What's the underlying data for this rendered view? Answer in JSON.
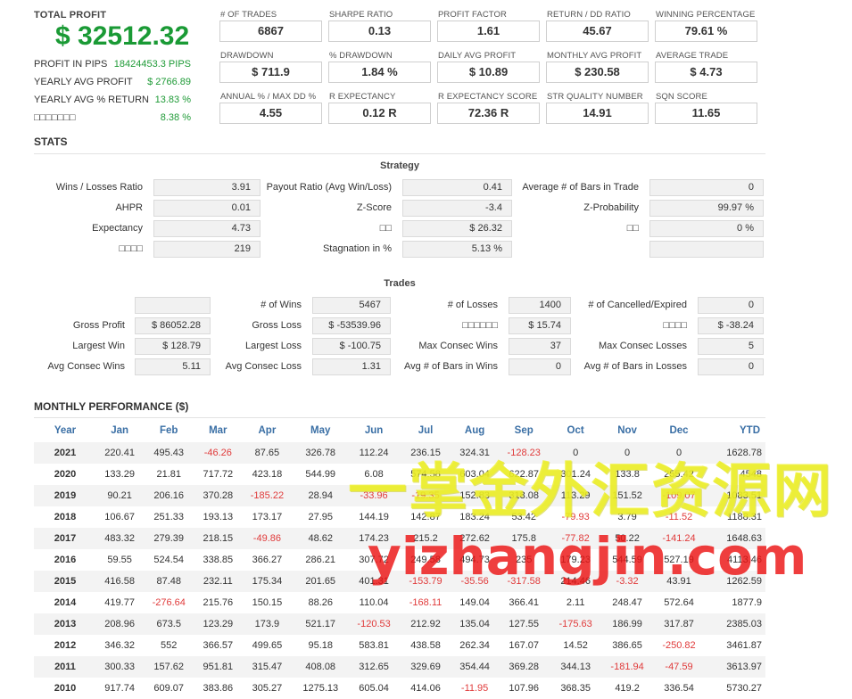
{
  "summary": {
    "total_profit_label": "TOTAL PROFIT",
    "total_profit_value": "$ 32512.32",
    "rows": [
      {
        "label": "PROFIT IN PIPS",
        "value": "18424453.3 PIPS"
      },
      {
        "label": "YEARLY AVG PROFIT",
        "value": "$ 2766.89"
      },
      {
        "label": "YEARLY AVG % RETURN",
        "value": "13.83 %"
      },
      {
        "label": "□□□□□□□",
        "value": "8.38 %"
      }
    ]
  },
  "stat_boxes": [
    {
      "label": "# OF TRADES",
      "value": "6867"
    },
    {
      "label": "SHARPE RATIO",
      "value": "0.13"
    },
    {
      "label": "PROFIT FACTOR",
      "value": "1.61"
    },
    {
      "label": "RETURN / DD RATIO",
      "value": "45.67"
    },
    {
      "label": "WINNING PERCENTAGE",
      "value": "79.61 %"
    },
    {
      "label": "DRAWDOWN",
      "value": "$ 711.9"
    },
    {
      "label": "% DRAWDOWN",
      "value": "1.84 %"
    },
    {
      "label": "DAILY AVG PROFIT",
      "value": "$ 10.89"
    },
    {
      "label": "MONTHLY AVG PROFIT",
      "value": "$ 230.58"
    },
    {
      "label": "AVERAGE TRADE",
      "value": "$ 4.73"
    },
    {
      "label": "ANNUAL % / MAX DD %",
      "value": "4.55"
    },
    {
      "label": "R EXPECTANCY",
      "value": "0.12 R"
    },
    {
      "label": "R EXPECTANCY SCORE",
      "value": "72.36 R"
    },
    {
      "label": "STR QUALITY NUMBER",
      "value": "14.91"
    },
    {
      "label": "SQN SCORE",
      "value": "11.65"
    }
  ],
  "stats_title": "STATS",
  "strategy": {
    "title": "Strategy",
    "rows": [
      [
        {
          "k": "Wins / Losses Ratio",
          "v": "3.91"
        },
        {
          "k": "Payout Ratio (Avg Win/Loss)",
          "v": "0.41"
        },
        {
          "k": "Average # of Bars in Trade",
          "v": "0"
        }
      ],
      [
        {
          "k": "AHPR",
          "v": "0.01"
        },
        {
          "k": "Z-Score",
          "v": "-3.4"
        },
        {
          "k": "Z-Probability",
          "v": "99.97 %"
        }
      ],
      [
        {
          "k": "Expectancy",
          "v": "4.73"
        },
        {
          "k": "□□",
          "v": "$ 26.32"
        },
        {
          "k": "□□",
          "v": "0 %"
        }
      ],
      [
        {
          "k": "□□□□",
          "v": "219"
        },
        {
          "k": "Stagnation in %",
          "v": "5.13 %"
        },
        {
          "k": "",
          "v": ""
        }
      ]
    ]
  },
  "trades": {
    "title": "Trades",
    "rows": [
      [
        {
          "k": "",
          "v": ""
        },
        {
          "k": "# of Wins",
          "v": "5467"
        },
        {
          "k": "# of Losses",
          "v": "1400"
        },
        {
          "k": "# of Cancelled/Expired",
          "v": "0"
        }
      ],
      [
        {
          "k": "Gross Profit",
          "v": "$ 86052.28"
        },
        {
          "k": "Gross Loss",
          "v": "$ -53539.96"
        },
        {
          "k": "□□□□□□",
          "v": "$ 15.74"
        },
        {
          "k": "□□□□",
          "v": "$ -38.24"
        }
      ],
      [
        {
          "k": "Largest Win",
          "v": "$ 128.79"
        },
        {
          "k": "Largest Loss",
          "v": "$ -100.75"
        },
        {
          "k": "Max Consec Wins",
          "v": "37"
        },
        {
          "k": "Max Consec Losses",
          "v": "5"
        }
      ],
      [
        {
          "k": "Avg Consec Wins",
          "v": "5.11"
        },
        {
          "k": "Avg Consec Loss",
          "v": "1.31"
        },
        {
          "k": "Avg # of Bars in Wins",
          "v": "0"
        },
        {
          "k": "Avg # of Bars in Losses",
          "v": "0"
        }
      ]
    ]
  },
  "monthly": {
    "title": "MONTHLY PERFORMANCE ($)",
    "headers": [
      "Year",
      "Jan",
      "Feb",
      "Mar",
      "Apr",
      "May",
      "Jun",
      "Jul",
      "Aug",
      "Sep",
      "Oct",
      "Nov",
      "Dec",
      "YTD"
    ],
    "rows": [
      [
        "2021",
        "220.41",
        "495.43",
        "-46.26",
        "87.65",
        "326.78",
        "112.24",
        "236.15",
        "324.31",
        "-128.23",
        "0",
        "0",
        "0",
        "1628.78"
      ],
      [
        "2020",
        "133.29",
        "21.81",
        "717.72",
        "423.18",
        "544.99",
        "6.08",
        "574.58",
        "603.04",
        "622.87",
        "301.24",
        "133.8",
        "255.42",
        "4548"
      ],
      [
        "2019",
        "90.21",
        "206.16",
        "370.28",
        "-185.22",
        "28.94",
        "-33.96",
        "-19.35",
        "152.83",
        "318.08",
        "113.29",
        "151.52",
        "-109.07",
        "1083.51"
      ],
      [
        "2018",
        "106.67",
        "251.33",
        "193.13",
        "173.17",
        "27.95",
        "144.19",
        "142.87",
        "183.24",
        "53.42",
        "-79.93",
        "3.79",
        "-11.52",
        "1188.31"
      ],
      [
        "2017",
        "483.32",
        "279.39",
        "218.15",
        "-49.86",
        "48.62",
        "174.23",
        "215.2",
        "272.62",
        "175.8",
        "-77.82",
        "50.22",
        "-141.24",
        "1648.63"
      ],
      [
        "2016",
        "59.55",
        "524.54",
        "338.85",
        "366.27",
        "286.21",
        "307.72",
        "249.58",
        "494.73",
        "235",
        "179.23",
        "544.59",
        "527.19",
        "4113.46"
      ],
      [
        "2015",
        "416.58",
        "87.48",
        "232.11",
        "175.34",
        "201.65",
        "401.31",
        "-153.79",
        "-35.56",
        "-317.58",
        "214.46",
        "-3.32",
        "43.91",
        "1262.59"
      ],
      [
        "2014",
        "419.77",
        "-276.64",
        "215.76",
        "150.15",
        "88.26",
        "110.04",
        "-168.11",
        "149.04",
        "366.41",
        "2.11",
        "248.47",
        "572.64",
        "1877.9"
      ],
      [
        "2013",
        "208.96",
        "673.5",
        "123.29",
        "173.9",
        "521.17",
        "-120.53",
        "212.92",
        "135.04",
        "127.55",
        "-175.63",
        "186.99",
        "317.87",
        "2385.03"
      ],
      [
        "2012",
        "346.32",
        "552",
        "366.57",
        "499.65",
        "95.18",
        "583.81",
        "438.58",
        "262.34",
        "167.07",
        "14.52",
        "386.65",
        "-250.82",
        "3461.87"
      ],
      [
        "2011",
        "300.33",
        "157.62",
        "951.81",
        "315.47",
        "408.08",
        "312.65",
        "329.69",
        "354.44",
        "369.28",
        "344.13",
        "-181.94",
        "-47.59",
        "3613.97"
      ],
      [
        "2010",
        "917.74",
        "609.07",
        "383.86",
        "305.27",
        "1275.13",
        "605.04",
        "414.06",
        "-11.95",
        "107.96",
        "368.35",
        "419.2",
        "336.54",
        "5730.27"
      ]
    ]
  },
  "watermark": {
    "line1": "一掌金外汇资源网",
    "line2": "yizhangjin.com"
  },
  "colors": {
    "profit_green": "#1a9a35",
    "negative_red": "#e03a3a",
    "header_blue": "#3a6fa5",
    "watermark_yellow": "#eef028",
    "watermark_red": "#eb1414"
  }
}
